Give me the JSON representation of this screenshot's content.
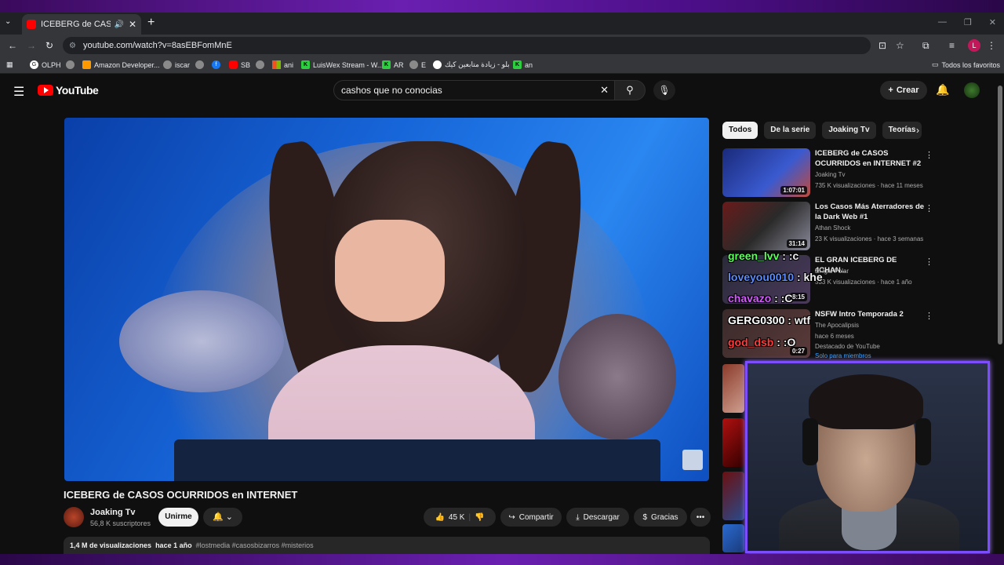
{
  "browser": {
    "tab_title": "ICEBERG de CASOS OCURRIDOS en INTERNET",
    "url": "youtube.com/watch?v=8asEBFomMnE",
    "profile_initial": "L",
    "bookmarks": [
      "OLPH",
      "Amazon Developer...",
      "iscar",
      "SB",
      "ani",
      "LuisWex Stream - W...",
      "AR",
      "E",
      "بلو - زيادة متابعين كيك",
      "an"
    ],
    "all_bookmarks": "Todos los favoritos"
  },
  "youtube": {
    "logo_text": "YouTube",
    "search_query": "cashos que no conocias",
    "create_label": "Crear"
  },
  "video": {
    "title": "ICEBERG de CASOS OCURRIDOS en INTERNET",
    "channel": "Joaking Tv",
    "subscribers": "56,8 K suscriptores",
    "join_label": "Unirme",
    "likes": "45 K",
    "share_label": "Compartir",
    "download_label": "Descargar",
    "thanks_label": "Gracias",
    "views": "1,4 M de visualizaciones",
    "age": "hace 1 año",
    "hashtags": "#lostmedia #casosbizarros #misterios"
  },
  "chips": [
    "Todos",
    "De la serie",
    "Joaking Tv",
    "Teorías"
  ],
  "recommendations": [
    {
      "title": "ICEBERG de CASOS OCURRIDOS en INTERNET #2",
      "channel": "Joaking Tv",
      "meta": "735 K visualizaciones · hace 11 meses",
      "duration": "1:07:01",
      "thumb_color": "#3a4fbf"
    },
    {
      "title": "Los Casos Más Aterradores de la Dark Web #1",
      "channel": "Athan Shock",
      "meta": "23 K visualizaciones · hace 3 semanas",
      "duration": "31:14",
      "thumb_color": "#5a1a1a"
    },
    {
      "title": "EL GRAN ICEBERG DE 4CHAN...",
      "channel": "El Iglu Polar",
      "meta": "533 K visualizaciones · hace 1 año",
      "duration": "8:15",
      "thumb_color": "#2a2a3a"
    },
    {
      "title": "NSFW Intro Temporada 2",
      "channel": "The Apocalipsis",
      "meta": "hace 6 meses",
      "badge": "Destacado de YouTube",
      "members": "Solo para miembros",
      "duration": "0:27",
      "thumb_color": "#3a2a2a"
    }
  ],
  "chat": [
    {
      "user": "green_lvv",
      "msg": ": :c",
      "color": "#5cff5c"
    },
    {
      "user": "loveyou0010",
      "msg": ": khe",
      "color": "#5a8cff"
    },
    {
      "user": "chavazo",
      "msg": ": :C",
      "color": "#d45cff"
    },
    {
      "user": "GERG0300",
      "msg": ": wtf",
      "color": "#ffffff"
    },
    {
      "user": "god_dsb",
      "msg": ": :O",
      "color": "#ff3b3b"
    }
  ]
}
